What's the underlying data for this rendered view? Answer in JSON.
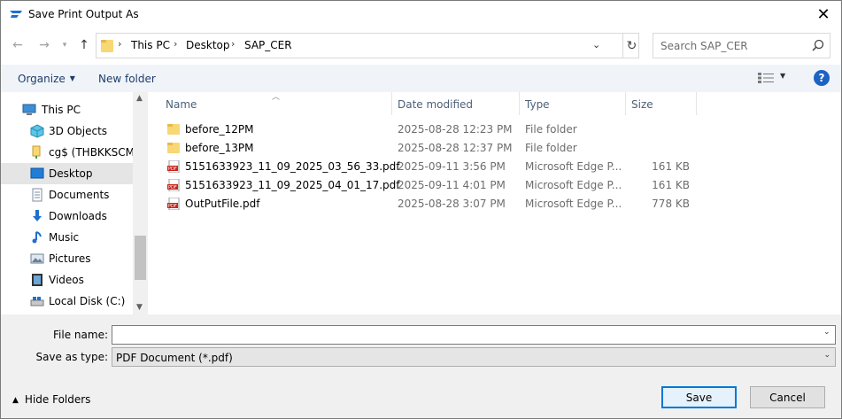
{
  "window": {
    "title": "Save Print Output As"
  },
  "address": {
    "crumbs": [
      "This PC",
      "Desktop",
      "SAP_CER"
    ]
  },
  "search": {
    "placeholder": "Search SAP_CER"
  },
  "toolbar": {
    "organize": "Organize",
    "new_folder": "New folder",
    "help": "?"
  },
  "nav": {
    "items": [
      {
        "label": "This PC",
        "icon": "pc-icon"
      },
      {
        "label": "3D Objects",
        "icon": "cube-icon"
      },
      {
        "label": "cg$ (THBKKSCMR",
        "icon": "network-drive-icon"
      },
      {
        "label": "Desktop",
        "icon": "desktop-icon",
        "selected": true
      },
      {
        "label": "Documents",
        "icon": "documents-icon"
      },
      {
        "label": "Downloads",
        "icon": "downloads-icon"
      },
      {
        "label": "Music",
        "icon": "music-icon"
      },
      {
        "label": "Pictures",
        "icon": "pictures-icon"
      },
      {
        "label": "Videos",
        "icon": "videos-icon"
      },
      {
        "label": "Local Disk (C:)",
        "icon": "disk-icon"
      }
    ]
  },
  "columns": {
    "name": "Name",
    "date": "Date modified",
    "type": "Type",
    "size": "Size"
  },
  "files": [
    {
      "name": "before_12PM",
      "date": "2025-08-28 12:23 PM",
      "type": "File folder",
      "size": "",
      "kind": "folder"
    },
    {
      "name": "before_13PM",
      "date": "2025-08-28 12:37 PM",
      "type": "File folder",
      "size": "",
      "kind": "folder"
    },
    {
      "name": "5151633923_11_09_2025_03_56_33.pdf",
      "date": "2025-09-11 3:56 PM",
      "type": "Microsoft Edge P...",
      "size": "161 KB",
      "kind": "pdf"
    },
    {
      "name": "5151633923_11_09_2025_04_01_17.pdf",
      "date": "2025-09-11 4:01 PM",
      "type": "Microsoft Edge P...",
      "size": "161 KB",
      "kind": "pdf"
    },
    {
      "name": "OutPutFile.pdf",
      "date": "2025-08-28 3:07 PM",
      "type": "Microsoft Edge P...",
      "size": "778 KB",
      "kind": "pdf"
    }
  ],
  "form": {
    "file_name_label": "File name:",
    "file_name_value": "",
    "save_type_label": "Save as type:",
    "save_type_value": "PDF Document (*.pdf)"
  },
  "footer": {
    "hide_folders": "Hide Folders",
    "save": "Save",
    "cancel": "Cancel"
  },
  "colors": {
    "accent": "#0078d7",
    "selected_bg": "#cce8ff",
    "pdf_red": "#c7241b",
    "folder_yellow": "#f8d775"
  }
}
